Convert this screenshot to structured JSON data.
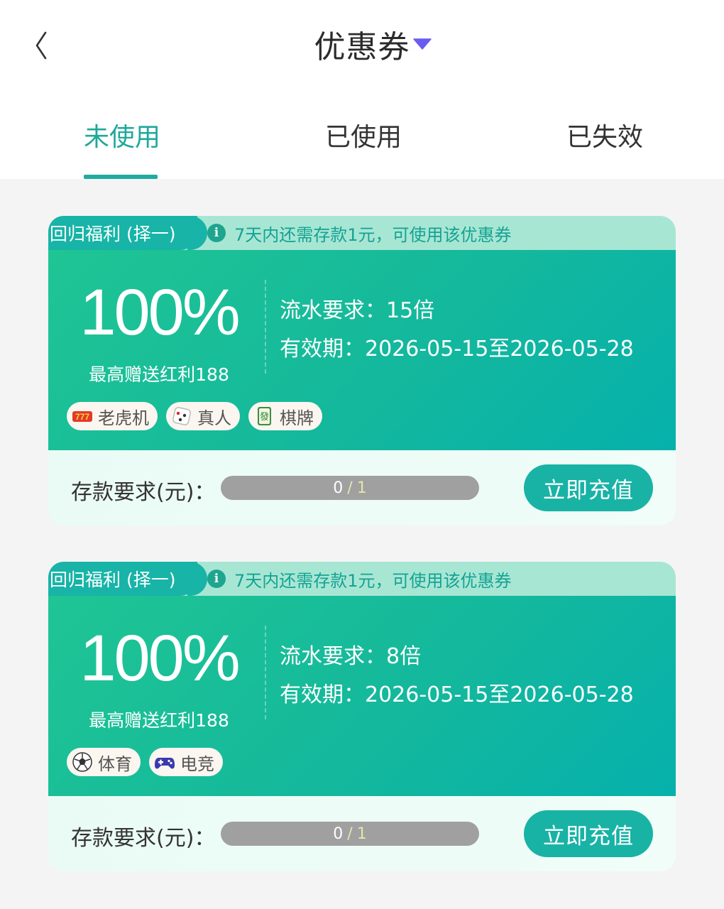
{
  "header": {
    "title": "优惠券"
  },
  "tabs": [
    {
      "label": "未使用",
      "active": true
    },
    {
      "label": "已使用",
      "active": false
    },
    {
      "label": "已失效",
      "active": false
    }
  ],
  "colors": {
    "accent": "#1fa89b",
    "card_gradient_start": "#1fc594",
    "card_gradient_end": "#06b1ac"
  },
  "coupons": [
    {
      "tag": "回归福利 (择一)",
      "tip": "7天内还需存款1元，可使用该优惠券",
      "percent": "100%",
      "bonus": "最高赠送红利188",
      "turnover": "流水要求：15倍",
      "validity": "有效期：2026-05-15至2026-05-28",
      "games": [
        {
          "icon": "slot-machine-icon",
          "label": "老虎机"
        },
        {
          "icon": "dice-icon",
          "label": "真人"
        },
        {
          "icon": "mahjong-tile-icon",
          "label": "棋牌"
        }
      ],
      "deposit_label": "存款要求(元)：",
      "deposit_current": "0",
      "deposit_sep": "/",
      "deposit_total": "1",
      "deposit_fraction": 0,
      "button": "立即充值"
    },
    {
      "tag": "回归福利 (择一)",
      "tip": "7天内还需存款1元，可使用该优惠券",
      "percent": "100%",
      "bonus": "最高赠送红利188",
      "turnover": "流水要求：8倍",
      "validity": "有效期：2026-05-15至2026-05-28",
      "games": [
        {
          "icon": "soccer-ball-icon",
          "label": "体育"
        },
        {
          "icon": "gamepad-icon",
          "label": "电竞"
        }
      ],
      "deposit_label": "存款要求(元)：",
      "deposit_current": "0",
      "deposit_sep": "/",
      "deposit_total": "1",
      "deposit_fraction": 0,
      "button": "立即充值"
    }
  ]
}
